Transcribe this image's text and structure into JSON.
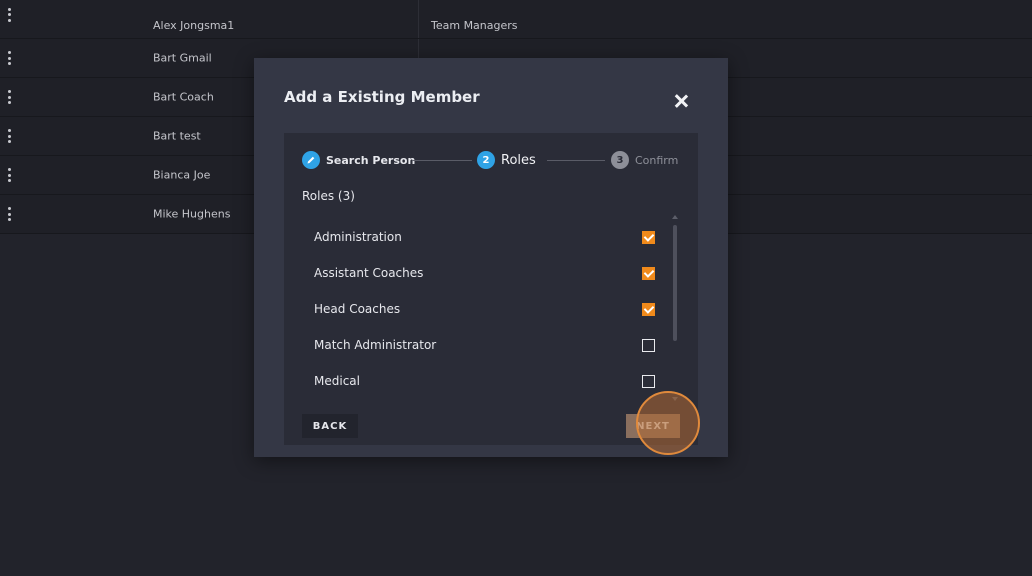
{
  "table": {
    "rows": [
      {
        "name": "Alex Jongsma1",
        "role": "Team Managers"
      },
      {
        "name": "Bart Gmail",
        "role": ""
      },
      {
        "name": "Bart Coach",
        "role": ""
      },
      {
        "name": "Bart test",
        "role": ""
      },
      {
        "name": "Bianca Joe",
        "role": ""
      },
      {
        "name": "Mike Hughens",
        "role": ""
      }
    ]
  },
  "modal": {
    "title": "Add a Existing Member",
    "stepper": {
      "steps": [
        {
          "number": "",
          "label": "Search Person",
          "state": "completed",
          "icon": "pencil-icon"
        },
        {
          "number": "2",
          "label": "Roles",
          "state": "active"
        },
        {
          "number": "3",
          "label": "Confirm",
          "state": "pending"
        }
      ]
    },
    "roles_title": "Roles (3)",
    "roles": [
      {
        "label": "Administration",
        "checked": true
      },
      {
        "label": "Assistant Coaches",
        "checked": true
      },
      {
        "label": "Head Coaches",
        "checked": true
      },
      {
        "label": "Match Administrator",
        "checked": false
      },
      {
        "label": "Medical",
        "checked": false
      }
    ],
    "back_label": "BACK",
    "next_label": "NEXT"
  },
  "colors": {
    "accent_orange": "#f08a1b",
    "step_blue": "#2fa3e6",
    "background": "#22232b",
    "modal": "#343745"
  }
}
